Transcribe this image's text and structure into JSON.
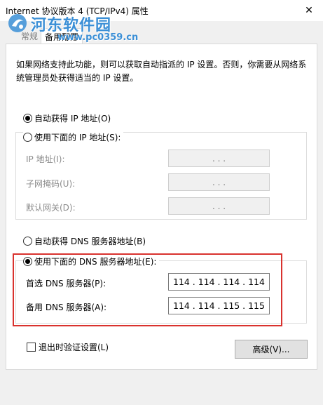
{
  "window": {
    "title": "Internet 协议版本 4 (TCP/IPv4) 属性",
    "close_glyph": "✕"
  },
  "watermark": {
    "name": "河东软件园",
    "url": "www.pc0359.cn"
  },
  "tabs": [
    {
      "label": "常规",
      "selected": false
    },
    {
      "label": "备用配置",
      "selected": true
    }
  ],
  "description": "如果网络支持此功能，则可以获取自动指派的 IP 设置。否则，你需要从网络系统管理员处获得适当的 IP 设置。",
  "ip_section": {
    "auto_label": "自动获得 IP 地址(O)",
    "auto_selected": true,
    "manual_label": "使用下面的 IP 地址(S):",
    "manual_selected": false,
    "fields": [
      {
        "label": "IP 地址(I):",
        "value": ". . ."
      },
      {
        "label": "子网掩码(U):",
        "value": ". . ."
      },
      {
        "label": "默认网关(D):",
        "value": ". . ."
      }
    ]
  },
  "dns_section": {
    "auto_label": "自动获得 DNS 服务器地址(B)",
    "auto_selected": false,
    "manual_label": "使用下面的 DNS 服务器地址(E):",
    "manual_selected": true,
    "preferred": {
      "label": "首选 DNS 服务器(P):",
      "octets": [
        "114",
        ".",
        "114",
        ".",
        "114",
        ".",
        "114"
      ]
    },
    "alternate": {
      "label": "备用 DNS 服务器(A):",
      "octets": [
        "114",
        ".",
        "114",
        ".",
        "115",
        ".",
        "115"
      ]
    }
  },
  "validate_label": "退出时验证设置(L)",
  "validate_checked": false,
  "advanced_button": "高级(V)...",
  "colors": {
    "highlight": "#d9322e",
    "watermark": "#3b8fd6"
  }
}
